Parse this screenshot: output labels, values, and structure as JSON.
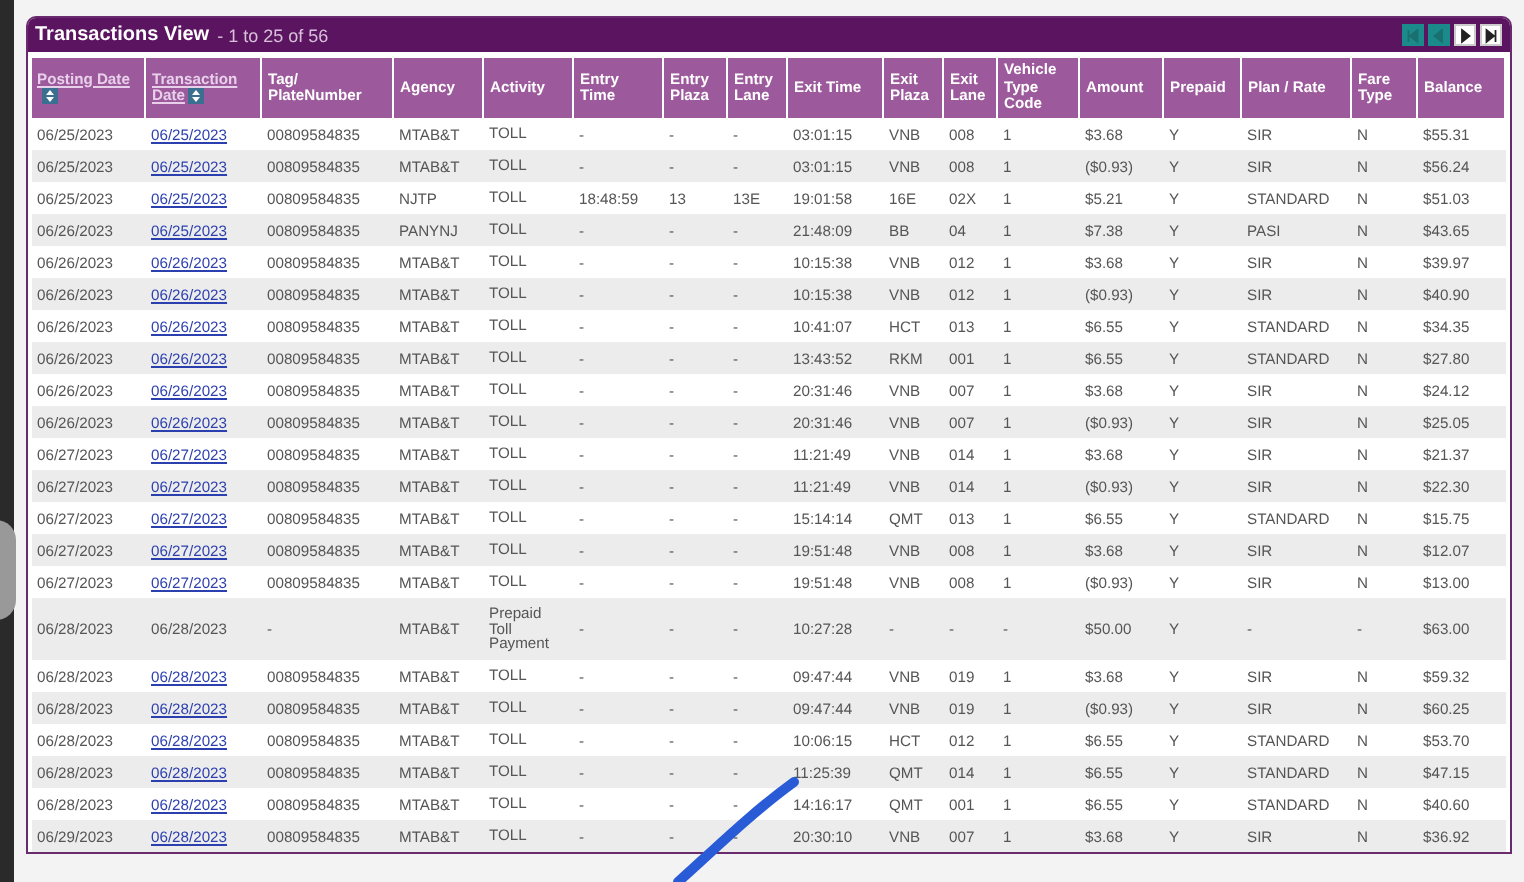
{
  "panel": {
    "title": "Transactions View",
    "range": "- 1 to 25 of 56",
    "pager": [
      {
        "kind": "first",
        "disabled": true
      },
      {
        "kind": "prev",
        "disabled": true
      },
      {
        "kind": "next",
        "disabled": false
      },
      {
        "kind": "last",
        "disabled": false
      }
    ]
  },
  "table": {
    "columns": [
      {
        "label": "Posting Date",
        "sortable": true
      },
      {
        "label": "Transaction Date",
        "sortable": true
      },
      {
        "label": "Tag/ PlateNumber",
        "sortable": false
      },
      {
        "label": "Agency",
        "sortable": false
      },
      {
        "label": "Activity",
        "sortable": false
      },
      {
        "label": "Entry Time",
        "sortable": false
      },
      {
        "label": "Entry Plaza",
        "sortable": false
      },
      {
        "label": "Entry Lane",
        "sortable": false
      },
      {
        "label": "Exit Time",
        "sortable": false
      },
      {
        "label": "Exit Plaza",
        "sortable": false
      },
      {
        "label": "Exit Lane",
        "sortable": false
      },
      {
        "label": "Vehicle Type Code",
        "sortable": false
      },
      {
        "label": "Amount",
        "sortable": false
      },
      {
        "label": "Prepaid",
        "sortable": false
      },
      {
        "label": "Plan / Rate",
        "sortable": false
      },
      {
        "label": "Fare Type",
        "sortable": false
      },
      {
        "label": "Balance",
        "sortable": false
      }
    ],
    "rows": [
      {
        "linked": true,
        "cells": [
          "06/25/2023",
          "06/25/2023",
          "00809584835",
          "MTAB&T",
          "TOLL",
          "-",
          "-",
          "-",
          "03:01:15",
          "VNB",
          "008",
          "1",
          "$3.68",
          "Y",
          "SIR",
          "N",
          "$55.31"
        ]
      },
      {
        "linked": true,
        "cells": [
          "06/25/2023",
          "06/25/2023",
          "00809584835",
          "MTAB&T",
          "TOLL",
          "-",
          "-",
          "-",
          "03:01:15",
          "VNB",
          "008",
          "1",
          "($0.93)",
          "Y",
          "SIR",
          "N",
          "$56.24"
        ]
      },
      {
        "linked": true,
        "cells": [
          "06/25/2023",
          "06/25/2023",
          "00809584835",
          "NJTP",
          "TOLL",
          "18:48:59",
          "13",
          "13E",
          "19:01:58",
          "16E",
          "02X",
          "1",
          "$5.21",
          "Y",
          "STANDARD",
          "N",
          "$51.03"
        ]
      },
      {
        "linked": true,
        "cells": [
          "06/26/2023",
          "06/25/2023",
          "00809584835",
          "PANYNJ",
          "TOLL",
          "-",
          "-",
          "-",
          "21:48:09",
          "BB",
          "04",
          "1",
          "$7.38",
          "Y",
          "PASI",
          "N",
          "$43.65"
        ]
      },
      {
        "linked": true,
        "cells": [
          "06/26/2023",
          "06/26/2023",
          "00809584835",
          "MTAB&T",
          "TOLL",
          "-",
          "-",
          "-",
          "10:15:38",
          "VNB",
          "012",
          "1",
          "$3.68",
          "Y",
          "SIR",
          "N",
          "$39.97"
        ]
      },
      {
        "linked": true,
        "cells": [
          "06/26/2023",
          "06/26/2023",
          "00809584835",
          "MTAB&T",
          "TOLL",
          "-",
          "-",
          "-",
          "10:15:38",
          "VNB",
          "012",
          "1",
          "($0.93)",
          "Y",
          "SIR",
          "N",
          "$40.90"
        ]
      },
      {
        "linked": true,
        "cells": [
          "06/26/2023",
          "06/26/2023",
          "00809584835",
          "MTAB&T",
          "TOLL",
          "-",
          "-",
          "-",
          "10:41:07",
          "HCT",
          "013",
          "1",
          "$6.55",
          "Y",
          "STANDARD",
          "N",
          "$34.35"
        ]
      },
      {
        "linked": true,
        "cells": [
          "06/26/2023",
          "06/26/2023",
          "00809584835",
          "MTAB&T",
          "TOLL",
          "-",
          "-",
          "-",
          "13:43:52",
          "RKM",
          "001",
          "1",
          "$6.55",
          "Y",
          "STANDARD",
          "N",
          "$27.80"
        ]
      },
      {
        "linked": true,
        "cells": [
          "06/26/2023",
          "06/26/2023",
          "00809584835",
          "MTAB&T",
          "TOLL",
          "-",
          "-",
          "-",
          "20:31:46",
          "VNB",
          "007",
          "1",
          "$3.68",
          "Y",
          "SIR",
          "N",
          "$24.12"
        ]
      },
      {
        "linked": true,
        "cells": [
          "06/26/2023",
          "06/26/2023",
          "00809584835",
          "MTAB&T",
          "TOLL",
          "-",
          "-",
          "-",
          "20:31:46",
          "VNB",
          "007",
          "1",
          "($0.93)",
          "Y",
          "SIR",
          "N",
          "$25.05"
        ]
      },
      {
        "linked": true,
        "cells": [
          "06/27/2023",
          "06/27/2023",
          "00809584835",
          "MTAB&T",
          "TOLL",
          "-",
          "-",
          "-",
          "11:21:49",
          "VNB",
          "014",
          "1",
          "$3.68",
          "Y",
          "SIR",
          "N",
          "$21.37"
        ]
      },
      {
        "linked": true,
        "cells": [
          "06/27/2023",
          "06/27/2023",
          "00809584835",
          "MTAB&T",
          "TOLL",
          "-",
          "-",
          "-",
          "11:21:49",
          "VNB",
          "014",
          "1",
          "($0.93)",
          "Y",
          "SIR",
          "N",
          "$22.30"
        ]
      },
      {
        "linked": true,
        "cells": [
          "06/27/2023",
          "06/27/2023",
          "00809584835",
          "MTAB&T",
          "TOLL",
          "-",
          "-",
          "-",
          "15:14:14",
          "QMT",
          "013",
          "1",
          "$6.55",
          "Y",
          "STANDARD",
          "N",
          "$15.75"
        ]
      },
      {
        "linked": true,
        "cells": [
          "06/27/2023",
          "06/27/2023",
          "00809584835",
          "MTAB&T",
          "TOLL",
          "-",
          "-",
          "-",
          "19:51:48",
          "VNB",
          "008",
          "1",
          "$3.68",
          "Y",
          "SIR",
          "N",
          "$12.07"
        ]
      },
      {
        "linked": true,
        "cells": [
          "06/27/2023",
          "06/27/2023",
          "00809584835",
          "MTAB&T",
          "TOLL",
          "-",
          "-",
          "-",
          "19:51:48",
          "VNB",
          "008",
          "1",
          "($0.93)",
          "Y",
          "SIR",
          "N",
          "$13.00"
        ]
      },
      {
        "linked": false,
        "cells": [
          "06/28/2023",
          "06/28/2023",
          "-",
          "MTAB&T",
          "Prepaid Toll Payment",
          "-",
          "-",
          "-",
          "10:27:28",
          "-",
          "-",
          "-",
          "$50.00",
          "Y",
          "-",
          "-",
          "$63.00"
        ]
      },
      {
        "linked": true,
        "cells": [
          "06/28/2023",
          "06/28/2023",
          "00809584835",
          "MTAB&T",
          "TOLL",
          "-",
          "-",
          "-",
          "09:47:44",
          "VNB",
          "019",
          "1",
          "$3.68",
          "Y",
          "SIR",
          "N",
          "$59.32"
        ]
      },
      {
        "linked": true,
        "cells": [
          "06/28/2023",
          "06/28/2023",
          "00809584835",
          "MTAB&T",
          "TOLL",
          "-",
          "-",
          "-",
          "09:47:44",
          "VNB",
          "019",
          "1",
          "($0.93)",
          "Y",
          "SIR",
          "N",
          "$60.25"
        ]
      },
      {
        "linked": true,
        "cells": [
          "06/28/2023",
          "06/28/2023",
          "00809584835",
          "MTAB&T",
          "TOLL",
          "-",
          "-",
          "-",
          "10:06:15",
          "HCT",
          "012",
          "1",
          "$6.55",
          "Y",
          "STANDARD",
          "N",
          "$53.70"
        ]
      },
      {
        "linked": true,
        "cells": [
          "06/28/2023",
          "06/28/2023",
          "00809584835",
          "MTAB&T",
          "TOLL",
          "-",
          "-",
          "-",
          "11:25:39",
          "QMT",
          "014",
          "1",
          "$6.55",
          "Y",
          "STANDARD",
          "N",
          "$47.15"
        ]
      },
      {
        "linked": true,
        "cells": [
          "06/28/2023",
          "06/28/2023",
          "00809584835",
          "MTAB&T",
          "TOLL",
          "-",
          "-",
          "-",
          "14:16:17",
          "QMT",
          "001",
          "1",
          "$6.55",
          "Y",
          "STANDARD",
          "N",
          "$40.60"
        ]
      },
      {
        "linked": true,
        "cells": [
          "06/29/2023",
          "06/28/2023",
          "00809584835",
          "MTAB&T",
          "TOLL",
          "-",
          "-",
          "-",
          "20:30:10",
          "VNB",
          "007",
          "1",
          "$3.68",
          "Y",
          "SIR",
          "N",
          "$36.92"
        ]
      }
    ]
  }
}
